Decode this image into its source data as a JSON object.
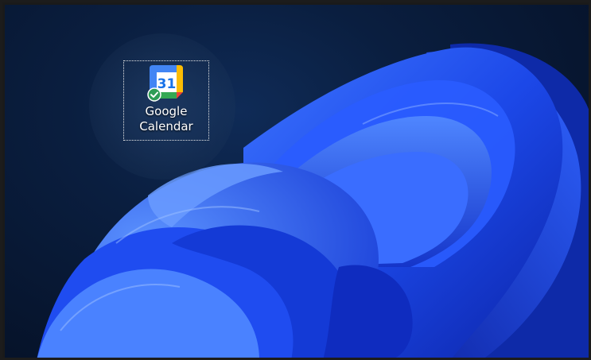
{
  "desktop": {
    "icons": [
      {
        "icon": "google-calendar-icon",
        "label_line1": "Google",
        "label_line2": "Calendar",
        "calendar_day": "31",
        "sync_status_icon": "checkmark-overlay-icon",
        "selected": true
      }
    ]
  },
  "colors": {
    "wallpaper_bloom": "#1f55ff",
    "background": "#0a1e3f",
    "calendar_blue": "#4285f4",
    "calendar_green": "#34a853",
    "calendar_yellow": "#fbbc04",
    "calendar_red": "#ea4335",
    "sync_green": "#2e9d55"
  }
}
